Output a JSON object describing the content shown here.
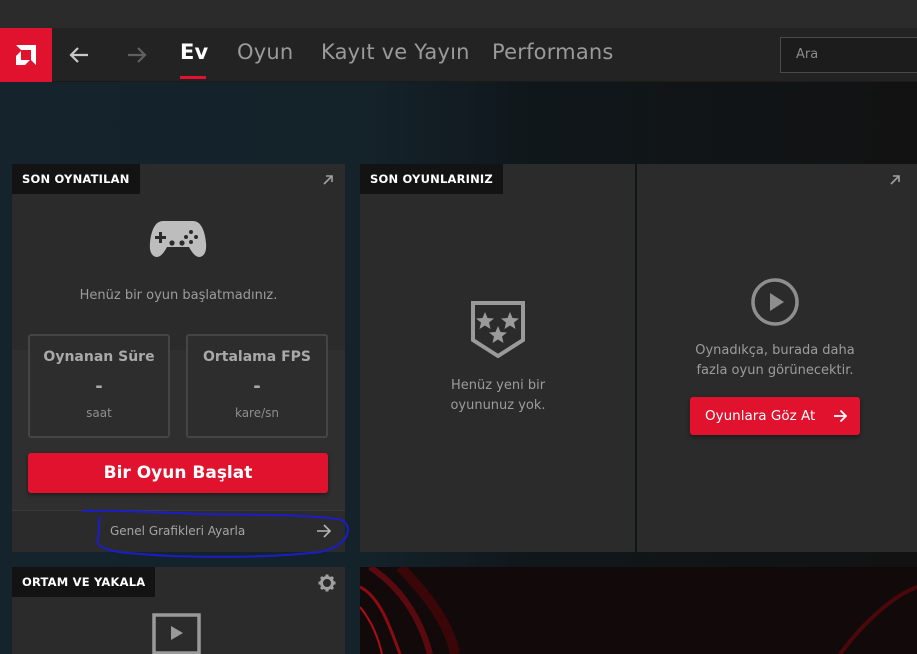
{
  "nav": {
    "tabs": [
      {
        "label": "Ev",
        "active": true
      },
      {
        "label": "Oyun",
        "active": false
      },
      {
        "label": "Kayıt ve Yayın",
        "active": false
      },
      {
        "label": "Performans",
        "active": false
      }
    ],
    "search_placeholder": "Ara",
    "accent_color": "#e0122d"
  },
  "recent": {
    "tag": "SON OYNATILAN",
    "empty_text": "Henüz bir oyun başlatmadınız.",
    "stats": [
      {
        "title": "Oynanan Süre",
        "value": "-",
        "unit": "saat"
      },
      {
        "title": "Ortalama FPS",
        "value": "-",
        "unit": "kare/sn"
      }
    ],
    "start_button": "Bir Oyun Başlat",
    "settings_link": "Genel Grafikleri Ayarla"
  },
  "games": {
    "tag": "SON OYUNLARINIZ",
    "empty_text": "Henüz yeni bir oyununuz yok.",
    "more_text": "Oynadıkça, burada daha fazla oyun görünecektir.",
    "browse_button": "Oyunlara Göz At"
  },
  "media": {
    "tag": "ORTAM VE YAKALA"
  }
}
